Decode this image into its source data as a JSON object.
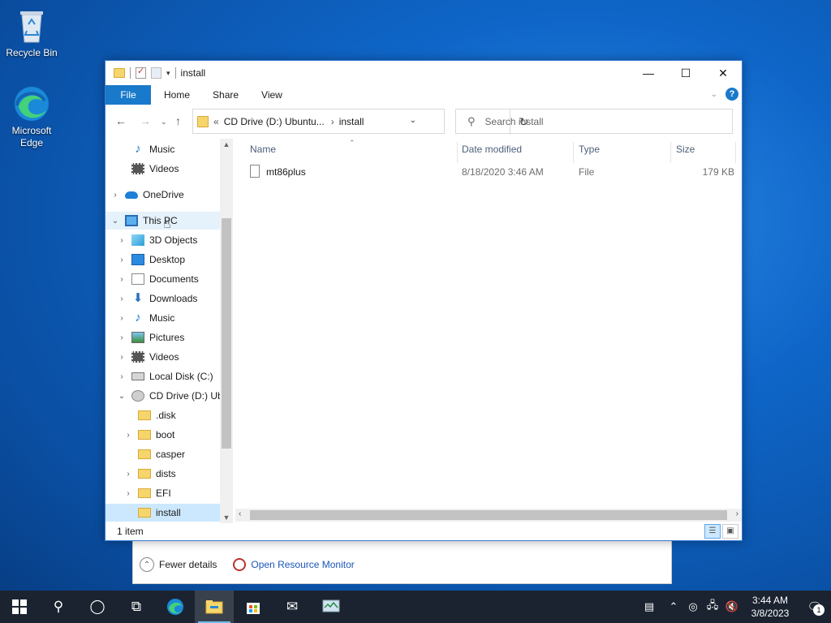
{
  "desktop": {
    "icons": [
      {
        "label": "Recycle Bin",
        "icon": "recycle-bin-icon"
      },
      {
        "label": "Microsoft Edge",
        "icon": "edge-icon"
      }
    ]
  },
  "task_manager": {
    "fewer_details": "Fewer details",
    "resource_monitor": "Open Resource Monitor"
  },
  "window": {
    "title": "install",
    "ribbon_tabs": [
      "File",
      "Home",
      "Share",
      "View"
    ],
    "address": {
      "root": "CD Drive (D:) Ubuntu...",
      "current": "install",
      "prefix": "«"
    },
    "search_placeholder": "Search install",
    "status": "1 item"
  },
  "nav_pane": {
    "items": [
      {
        "label": "Music",
        "icon": "music-icon"
      },
      {
        "label": "Videos",
        "icon": "videos-icon"
      },
      {
        "label": "OneDrive",
        "icon": "onedrive-icon"
      },
      {
        "label": "This PC",
        "icon": "this-pc-icon"
      },
      {
        "label": "3D Objects",
        "icon": "3d-objects-icon"
      },
      {
        "label": "Desktop",
        "icon": "desktop-icon"
      },
      {
        "label": "Documents",
        "icon": "documents-icon"
      },
      {
        "label": "Downloads",
        "icon": "downloads-icon"
      },
      {
        "label": "Music",
        "icon": "music-icon"
      },
      {
        "label": "Pictures",
        "icon": "pictures-icon"
      },
      {
        "label": "Videos",
        "icon": "videos-icon"
      },
      {
        "label": "Local Disk (C:)",
        "icon": "local-disk-icon"
      },
      {
        "label": "CD Drive (D:) Ub",
        "icon": "cd-drive-icon"
      },
      {
        "label": ".disk",
        "icon": "folder-icon"
      },
      {
        "label": "boot",
        "icon": "folder-icon"
      },
      {
        "label": "casper",
        "icon": "folder-icon"
      },
      {
        "label": "dists",
        "icon": "folder-icon"
      },
      {
        "label": "EFI",
        "icon": "folder-icon"
      },
      {
        "label": "install",
        "icon": "folder-icon"
      }
    ]
  },
  "columns": [
    "Name",
    "Date modified",
    "Type",
    "Size"
  ],
  "files": [
    {
      "name": "mt86plus",
      "date": "8/18/2020 3:46 AM",
      "type": "File",
      "size": "179 KB"
    }
  ],
  "taskbar": {
    "time": "3:44 AM",
    "date": "3/8/2023",
    "notifications": "1"
  },
  "colors": {
    "accent": "#1979ca",
    "taskbar": "#1b2330",
    "selection": "#cce8ff"
  }
}
